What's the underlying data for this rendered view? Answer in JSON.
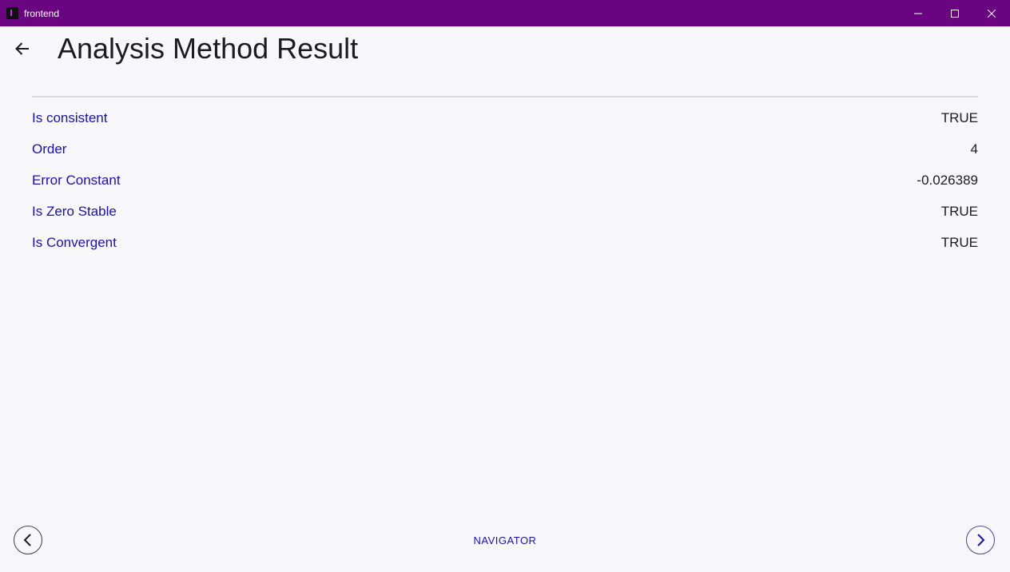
{
  "window": {
    "title": "frontend",
    "title_bar_color": "#6a0480"
  },
  "header": {
    "title": "Analysis Method Result",
    "back_icon": "arrow-left-icon"
  },
  "results": [
    {
      "label": "Is consistent",
      "value": "TRUE"
    },
    {
      "label": "Order",
      "value": "4"
    },
    {
      "label": "Error Constant",
      "value": "-0.026389"
    },
    {
      "label": "Is Zero Stable",
      "value": "TRUE"
    },
    {
      "label": "Is Convergent",
      "value": "TRUE"
    }
  ],
  "bottom_nav": {
    "title": "NAVIGATOR",
    "prev_icon": "chevron-left-icon",
    "next_icon": "chevron-right-icon"
  },
  "colors": {
    "label": "#1a12a8",
    "background": "#f8f7fc"
  }
}
